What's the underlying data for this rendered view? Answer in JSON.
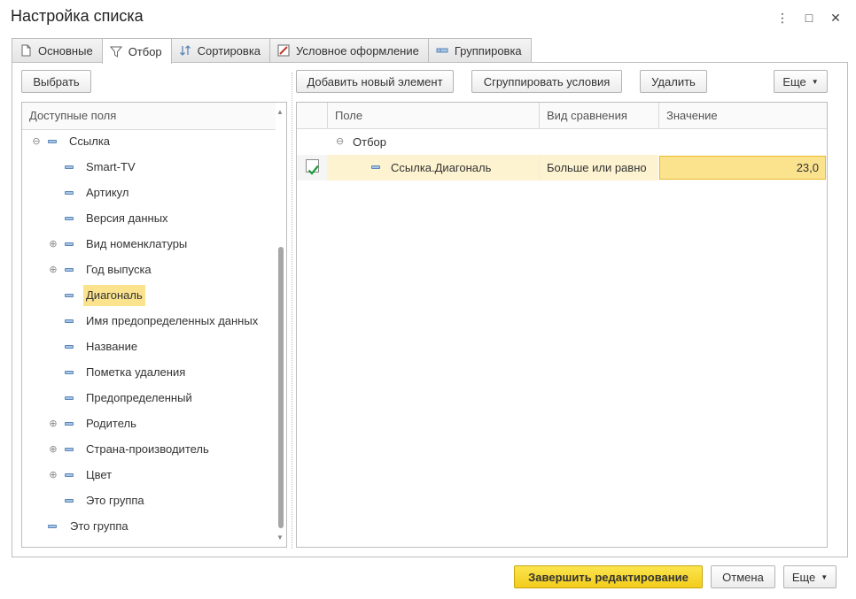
{
  "window": {
    "title": "Настройка списка",
    "menu_icon": "⋮",
    "maximize_icon": "□",
    "close_icon": "✕"
  },
  "tabs": [
    {
      "label": "Основные",
      "icon": "document-icon",
      "active": false
    },
    {
      "label": "Отбор",
      "icon": "filter-icon",
      "active": true
    },
    {
      "label": "Сортировка",
      "icon": "sort-icon",
      "active": false
    },
    {
      "label": "Условное оформление",
      "icon": "conditional-format-icon",
      "active": false
    },
    {
      "label": "Группировка",
      "icon": "grouping-icon",
      "active": false
    }
  ],
  "left": {
    "choose_button": "Выбрать",
    "header": "Доступные поля",
    "tree": [
      {
        "label": "Ссылка",
        "level": 0,
        "expander": "⊖"
      },
      {
        "label": "Smart-TV",
        "level": 1,
        "expander": ""
      },
      {
        "label": "Артикул",
        "level": 1,
        "expander": ""
      },
      {
        "label": "Версия данных",
        "level": 1,
        "expander": ""
      },
      {
        "label": "Вид номенклатуры",
        "level": 1,
        "expander": "⊕"
      },
      {
        "label": "Год выпуска",
        "level": 1,
        "expander": "⊕"
      },
      {
        "label": "Диагональ",
        "level": 1,
        "expander": "",
        "selected": true
      },
      {
        "label": "Имя предопределенных данных",
        "level": 1,
        "expander": ""
      },
      {
        "label": "Название",
        "level": 1,
        "expander": ""
      },
      {
        "label": "Пометка удаления",
        "level": 1,
        "expander": ""
      },
      {
        "label": "Предопределенный",
        "level": 1,
        "expander": ""
      },
      {
        "label": "Родитель",
        "level": 1,
        "expander": "⊕"
      },
      {
        "label": "Страна-производитель",
        "level": 1,
        "expander": "⊕"
      },
      {
        "label": "Цвет",
        "level": 1,
        "expander": "⊕"
      },
      {
        "label": "Это группа",
        "level": 1,
        "expander": ""
      },
      {
        "label": "Это группа",
        "level": 0,
        "expander": ""
      }
    ]
  },
  "right": {
    "add_button": "Добавить новый элемент",
    "group_button": "Сгруппировать условия",
    "delete_button": "Удалить",
    "more_button": "Еще",
    "columns": {
      "field": "Поле",
      "comparison": "Вид сравнения",
      "value": "Значение"
    },
    "group_row": {
      "expander": "⊖",
      "label": "Отбор"
    },
    "rows": [
      {
        "checked": true,
        "field": "Ссылка.Диагональ",
        "comparison": "Больше или равно",
        "value": "23,0"
      }
    ]
  },
  "footer": {
    "finish_button": "Завершить редактирование",
    "cancel_button": "Отмена",
    "more_button": "Еще"
  },
  "colors": {
    "primary_button": "#f3cc1c",
    "selection": "#fbe38e",
    "check": "#1a9a3a"
  }
}
